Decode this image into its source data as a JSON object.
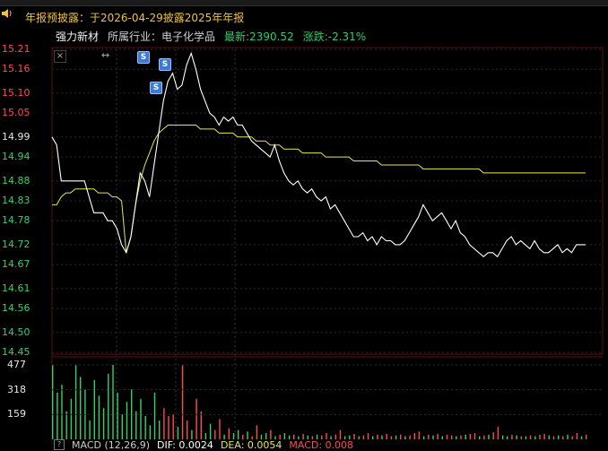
{
  "notice": {
    "text": "年报预披露：于2026-04-29披露2025年年报"
  },
  "stock": {
    "name": "强力新材",
    "industry_label": "所属行业：电子化学品",
    "latest": "最新:2390.52",
    "change": "涨跌:-2.31%"
  },
  "price_axis": [
    "15.21",
    "15.16",
    "15.10",
    "15.05",
    "14.99",
    "14.94",
    "14.88",
    "14.83",
    "14.78",
    "14.72",
    "14.67",
    "14.61",
    "14.56",
    "14.50",
    "14.45"
  ],
  "volume_axis": [
    "477",
    "318",
    "159"
  ],
  "toolbar": {
    "close_label": "×",
    "arrows_label": "↔"
  },
  "signal_marks": [
    "S",
    "S",
    "S",
    "S"
  ],
  "macd_legend": {
    "name": "MACD (12,26,9)",
    "dif": "DIF: 0.0024",
    "dea": "DEA: 0.0054",
    "macd": "MACD: 0.008"
  },
  "colors": {
    "price_line": "#ffffff",
    "avg_line": "#e8e84a",
    "up": "#ff4c4c",
    "down": "#32d26a",
    "notice": "#f0c040"
  },
  "chart_data": {
    "type": "line",
    "title": "",
    "series": [
      {
        "values": [
          14.99,
          14.97,
          14.88,
          14.88,
          14.88,
          14.88,
          14.88,
          14.88,
          14.84,
          14.8,
          14.8,
          14.8,
          14.78,
          14.78,
          14.76,
          14.72,
          14.7,
          14.74,
          14.82,
          14.9,
          14.88,
          14.84,
          14.92,
          15.0,
          15.08,
          15.13,
          15.15,
          15.11,
          15.12,
          15.17,
          15.2,
          15.16,
          15.11,
          15.08,
          15.05,
          15.04,
          15.02,
          15.04,
          15.03,
          15.04,
          15.02,
          15.02,
          15.0,
          14.98,
          14.97,
          14.96,
          14.95,
          14.94,
          14.97,
          14.93,
          14.9,
          14.88,
          14.87,
          14.88,
          14.86,
          14.85,
          14.86,
          14.84,
          14.83,
          14.84,
          14.81,
          14.82,
          14.8,
          14.78,
          14.76,
          14.74,
          14.74,
          14.75,
          14.73,
          14.74,
          14.72,
          14.74,
          14.73,
          14.73,
          14.72,
          14.72,
          14.73,
          14.75,
          14.77,
          14.79,
          14.82,
          14.8,
          14.78,
          14.79,
          14.8,
          14.78,
          14.76,
          14.78,
          14.75,
          14.74,
          14.72,
          14.71,
          14.7,
          14.69,
          14.7,
          14.7,
          14.69,
          14.71,
          14.73,
          14.74,
          14.72,
          14.73,
          14.72,
          14.71,
          14.73,
          14.71,
          14.7,
          14.7,
          14.71,
          14.72,
          14.7,
          14.71,
          14.7,
          14.72,
          14.72,
          14.72
        ]
      },
      {
        "values": [
          14.82,
          14.82,
          14.84,
          14.85,
          14.85,
          14.86,
          14.86,
          14.86,
          14.86,
          14.86,
          14.85,
          14.85,
          14.85,
          14.84,
          14.84,
          14.83,
          14.7,
          14.74,
          14.82,
          14.88,
          14.92,
          14.95,
          14.98,
          15.0,
          15.01,
          15.02,
          15.02,
          15.02,
          15.02,
          15.02,
          15.02,
          15.02,
          15.01,
          15.01,
          15.01,
          15.01,
          15.0,
          15.0,
          15.0,
          15.0,
          14.99,
          14.99,
          14.99,
          14.99,
          14.98,
          14.98,
          14.98,
          14.97,
          14.97,
          14.97,
          14.96,
          14.96,
          14.96,
          14.96,
          14.95,
          14.95,
          14.95,
          14.95,
          14.95,
          14.94,
          14.94,
          14.94,
          14.94,
          14.94,
          14.94,
          14.93,
          14.93,
          14.93,
          14.93,
          14.93,
          14.93,
          14.92,
          14.92,
          14.92,
          14.92,
          14.92,
          14.92,
          14.92,
          14.92,
          14.92,
          14.91,
          14.91,
          14.91,
          14.91,
          14.91,
          14.91,
          14.91,
          14.91,
          14.91,
          14.91,
          14.91,
          14.91,
          14.91,
          14.9,
          14.9,
          14.9,
          14.9,
          14.9,
          14.9,
          14.9,
          14.9,
          14.9,
          14.9,
          14.9,
          14.9,
          14.9,
          14.9,
          14.9,
          14.9,
          14.9,
          14.9,
          14.9,
          14.9,
          14.9,
          14.9,
          14.9
        ]
      }
    ],
    "ylim": [
      14.45,
      15.21
    ],
    "volume": {
      "ylim": [
        0,
        477
      ],
      "values": [
        477,
        300,
        350,
        180,
        260,
        477,
        400,
        320,
        120,
        380,
        280,
        200,
        420,
        477,
        300,
        160,
        240,
        320,
        180,
        260,
        150,
        90,
        300,
        120,
        200,
        150,
        160,
        80,
        477,
        120,
        60,
        260,
        180,
        40,
        100,
        60,
        130,
        30,
        70,
        40,
        60,
        30,
        50,
        20,
        90,
        30,
        40,
        60,
        20,
        30,
        40,
        25,
        30,
        20,
        35,
        25,
        20,
        30,
        25,
        40,
        20,
        30,
        60,
        20,
        25,
        35,
        20,
        25,
        40,
        20,
        30,
        25,
        35,
        20,
        25,
        30,
        20,
        25,
        40,
        50,
        20,
        30,
        25,
        35,
        20,
        30,
        25,
        20,
        25,
        30,
        35,
        40,
        20,
        25,
        30,
        45,
        80,
        25,
        20,
        30,
        25,
        20,
        20,
        25,
        20,
        30,
        35,
        25,
        20,
        25,
        20,
        30,
        20,
        40,
        20,
        30
      ],
      "colors": [
        "g",
        "g",
        "g",
        "g",
        "g",
        "g",
        "g",
        "g",
        "g",
        "g",
        "g",
        "g",
        "g",
        "g",
        "g",
        "g",
        "g",
        "g",
        "g",
        "g",
        "g",
        "g",
        "g",
        "g",
        "r",
        "r",
        "r",
        "g",
        "r",
        "r",
        "g",
        "r",
        "r",
        "g",
        "g",
        "r",
        "r",
        "g",
        "r",
        "g",
        "g",
        "r",
        "g",
        "r",
        "r",
        "g",
        "g",
        "r",
        "g",
        "r",
        "g",
        "g",
        "r",
        "g",
        "r",
        "g",
        "r",
        "g",
        "r",
        "r",
        "g",
        "r",
        "r",
        "g",
        "g",
        "r",
        "g",
        "r",
        "r",
        "g",
        "r",
        "g",
        "r",
        "r",
        "g",
        "r",
        "g",
        "r",
        "r",
        "r",
        "g",
        "r",
        "g",
        "r",
        "g",
        "r",
        "r",
        "g",
        "r",
        "g",
        "r",
        "r",
        "g",
        "r",
        "g",
        "r",
        "r",
        "g",
        "g",
        "r",
        "g",
        "r",
        "g",
        "r",
        "g",
        "r",
        "r",
        "g",
        "r",
        "g",
        "r",
        "g",
        "r",
        "r",
        "g",
        "r"
      ]
    }
  }
}
